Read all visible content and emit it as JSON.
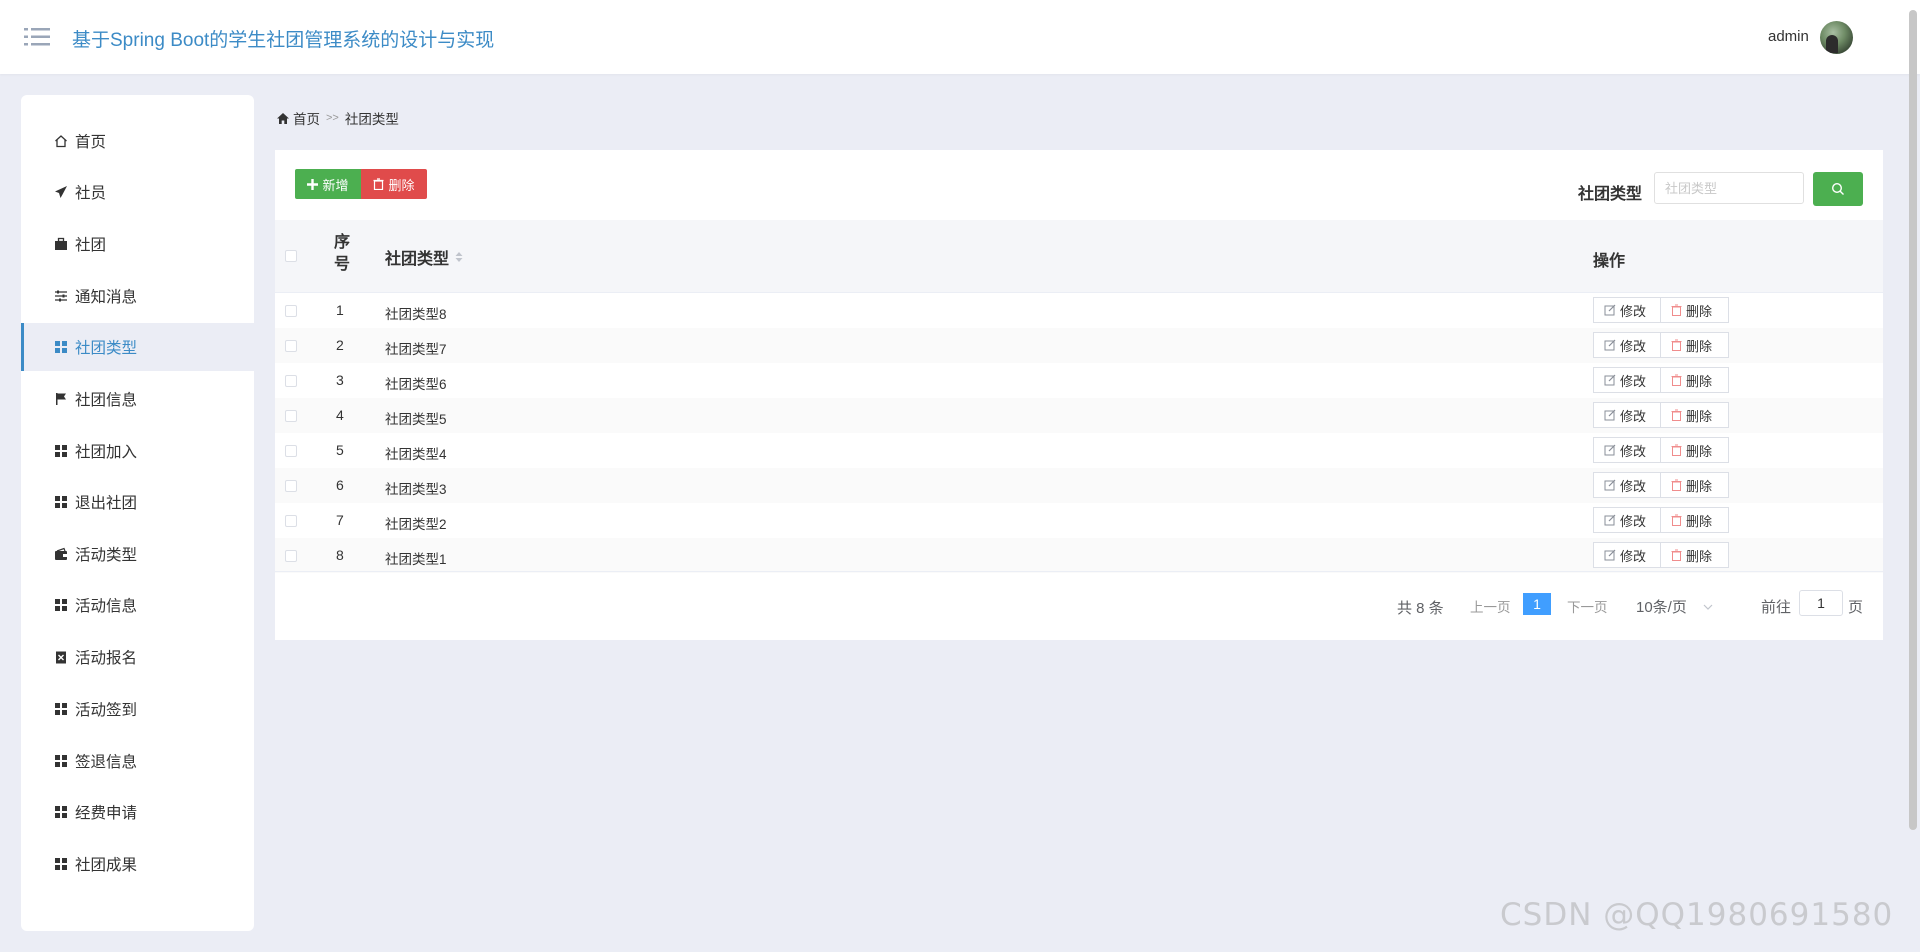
{
  "header": {
    "title": "基于Spring Boot的学生社团管理系统的设计与实现",
    "user": "admin"
  },
  "sidebar": {
    "items": [
      {
        "label": "首页",
        "icon": "home-icon"
      },
      {
        "label": "社员",
        "icon": "paper-plane-icon"
      },
      {
        "label": "社团",
        "icon": "briefcase-icon"
      },
      {
        "label": "通知消息",
        "icon": "sliders-icon"
      },
      {
        "label": "社团类型",
        "icon": "grid-icon",
        "active": true
      },
      {
        "label": "社团信息",
        "icon": "flag-icon"
      },
      {
        "label": "社团加入",
        "icon": "grid-icon"
      },
      {
        "label": "退出社团",
        "icon": "grid-icon"
      },
      {
        "label": "活动类型",
        "icon": "wallet-icon"
      },
      {
        "label": "活动信息",
        "icon": "grid-icon"
      },
      {
        "label": "活动报名",
        "icon": "clipboard-x-icon"
      },
      {
        "label": "活动签到",
        "icon": "grid-icon"
      },
      {
        "label": "签退信息",
        "icon": "grid-icon"
      },
      {
        "label": "经费申请",
        "icon": "grid-icon"
      },
      {
        "label": "社团成果",
        "icon": "grid-icon"
      }
    ]
  },
  "breadcrumb": {
    "home": "首页",
    "separator": ">>",
    "current": "社团类型"
  },
  "toolbar": {
    "add_label": "新增",
    "delete_label": "删除",
    "search_label": "社团类型",
    "search_placeholder": "社团类型"
  },
  "table": {
    "columns": {
      "index": "序号",
      "type": "社团类型",
      "ops": "操作"
    },
    "edit_label": "修改",
    "delete_label": "删除",
    "rows": [
      {
        "index": "1",
        "type": "社团类型8"
      },
      {
        "index": "2",
        "type": "社团类型7"
      },
      {
        "index": "3",
        "type": "社团类型6"
      },
      {
        "index": "4",
        "type": "社团类型5"
      },
      {
        "index": "5",
        "type": "社团类型4"
      },
      {
        "index": "6",
        "type": "社团类型3"
      },
      {
        "index": "7",
        "type": "社团类型2"
      },
      {
        "index": "8",
        "type": "社团类型1"
      }
    ]
  },
  "pagination": {
    "total": "共 8 条",
    "prev": "上一页",
    "current_page": "1",
    "next": "下一页",
    "page_size": "10条/页",
    "goto_label": "前往",
    "goto_value": "1",
    "goto_unit": "页"
  },
  "watermark": "CSDN @QQ1980691580",
  "colors": {
    "accent": "#3c8bc6",
    "add_button": "#4caf50",
    "delete_button": "#e04b4b",
    "page_active": "#409eff",
    "background": "#ebedf5"
  }
}
